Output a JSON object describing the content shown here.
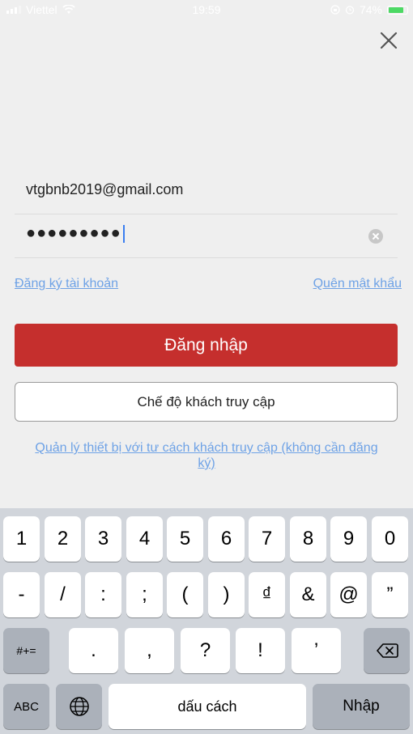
{
  "status_bar": {
    "carrier": "Viettel",
    "time": "19:59",
    "battery": "74%",
    "battery_level": 0.74
  },
  "icons": {
    "close": "close-icon",
    "wifi": "wifi-icon",
    "signal": "signal-icon",
    "alarm": "alarm-icon",
    "lock_rotation": "rotation-lock-icon",
    "battery": "battery-icon",
    "clear": "clear-icon",
    "globe": "globe-icon",
    "backspace": "backspace-icon"
  },
  "form": {
    "email_value": "vtgbnb2019@gmail.com",
    "password_value": "●●●●●●●●●"
  },
  "links": {
    "register": "Đăng ký tài khoản",
    "forgot": "Quên mật khẩu",
    "guest_manage": "Quản lý thiết bị với tư cách khách truy cập (không cần đăng ký)"
  },
  "buttons": {
    "login": "Đăng nhập",
    "guest": "Chế độ khách truy cập"
  },
  "keyboard": {
    "row1": [
      "1",
      "2",
      "3",
      "4",
      "5",
      "6",
      "7",
      "8",
      "9",
      "0"
    ],
    "row2": [
      "-",
      "/",
      ":",
      ";",
      "(",
      ")",
      "₫",
      "&",
      "@",
      "”"
    ],
    "row3": [
      ".",
      ",",
      "?",
      "!",
      "’"
    ],
    "more_symbols": "#+=",
    "abc": "ABC",
    "space": "dấu cách",
    "enter": "Nhập"
  },
  "colors": {
    "primary": "#c52f2d",
    "link": "#6ea2e6",
    "background": "#efefef",
    "keyboard_bg": "#d1d5db"
  }
}
